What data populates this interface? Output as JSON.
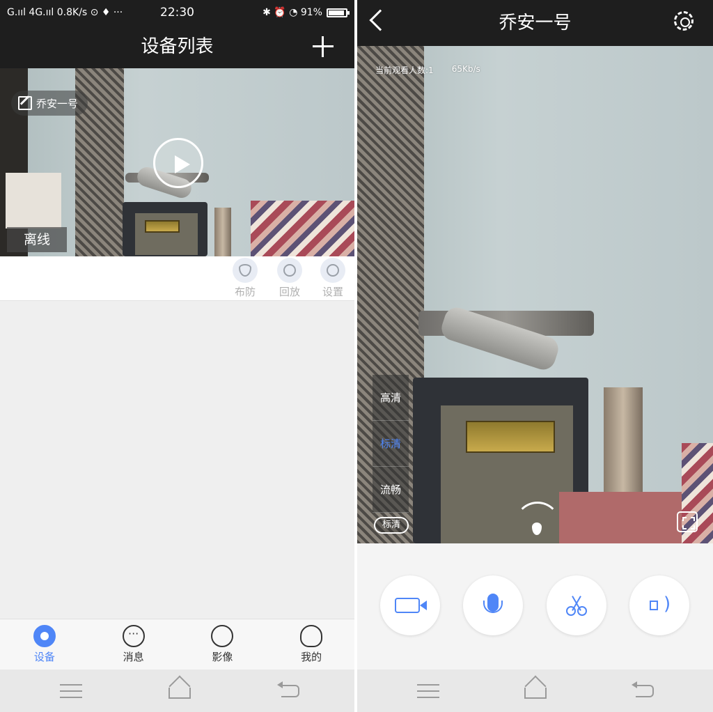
{
  "status_bar": {
    "left": "G.ııl 4G.ııl 0.8K/s ⊙ ♦ ···",
    "time": "22:30",
    "right": "✱ ⏰ ◔ 91%",
    "battery_level": 0.91
  },
  "device_list": {
    "title": "设备列表",
    "add_icon": "plus-icon",
    "device": {
      "name": "乔安一号",
      "status": "离线",
      "actions": [
        {
          "label": "布防",
          "icon": "shield-icon"
        },
        {
          "label": "回放",
          "icon": "replay-icon"
        },
        {
          "label": "设置",
          "icon": "gear-icon"
        }
      ]
    },
    "tabs": [
      {
        "label": "设备",
        "icon": "camera-icon",
        "active": true
      },
      {
        "label": "消息",
        "icon": "chat-icon",
        "active": false
      },
      {
        "label": "影像",
        "icon": "image-icon",
        "active": false
      },
      {
        "label": "我的",
        "icon": "person-icon",
        "active": false
      }
    ]
  },
  "live": {
    "title": "乔安一号",
    "viewers": "当前观看人数:1",
    "bitrate": "65Kb/s",
    "quality_options": [
      "高清",
      "标清",
      "流畅"
    ],
    "selected_quality": "标清",
    "quality_pill": "标清",
    "controls": [
      {
        "name": "record",
        "icon": "video-camera-icon"
      },
      {
        "name": "talk",
        "icon": "microphone-icon"
      },
      {
        "name": "screenshot",
        "icon": "scissors-icon"
      },
      {
        "name": "sound",
        "icon": "speaker-icon"
      }
    ]
  },
  "colors": {
    "accent": "#4f86f7",
    "header_bg": "#1e1e1e"
  }
}
